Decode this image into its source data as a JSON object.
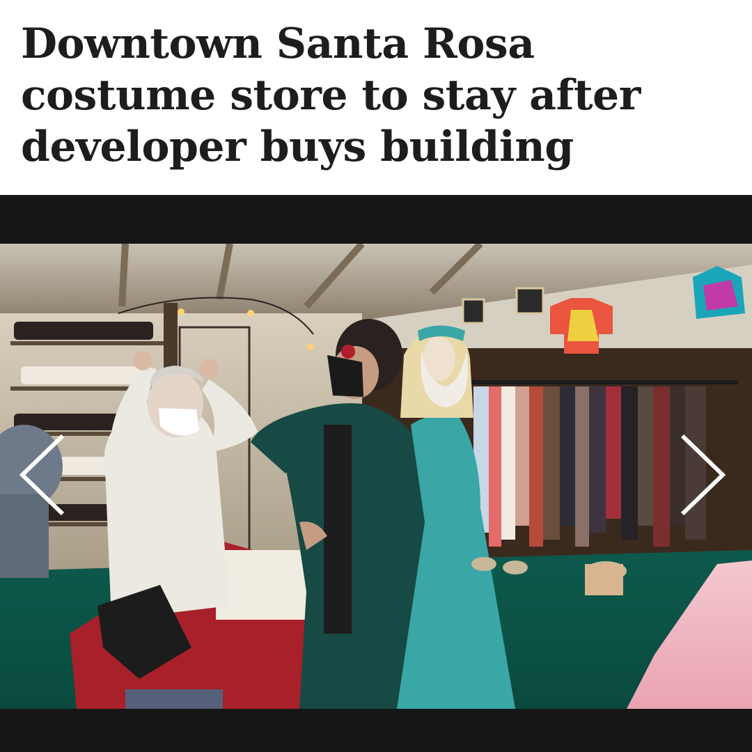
{
  "article": {
    "headline_lines": [
      "Downtown Santa Rosa",
      "costume store to stay after",
      "developer buys building"
    ]
  },
  "gallery": {
    "prev_icon": "chevron-left-icon",
    "next_icon": "chevron-right-icon",
    "arrow_color": "#ffffff",
    "band_color": "#161616"
  }
}
